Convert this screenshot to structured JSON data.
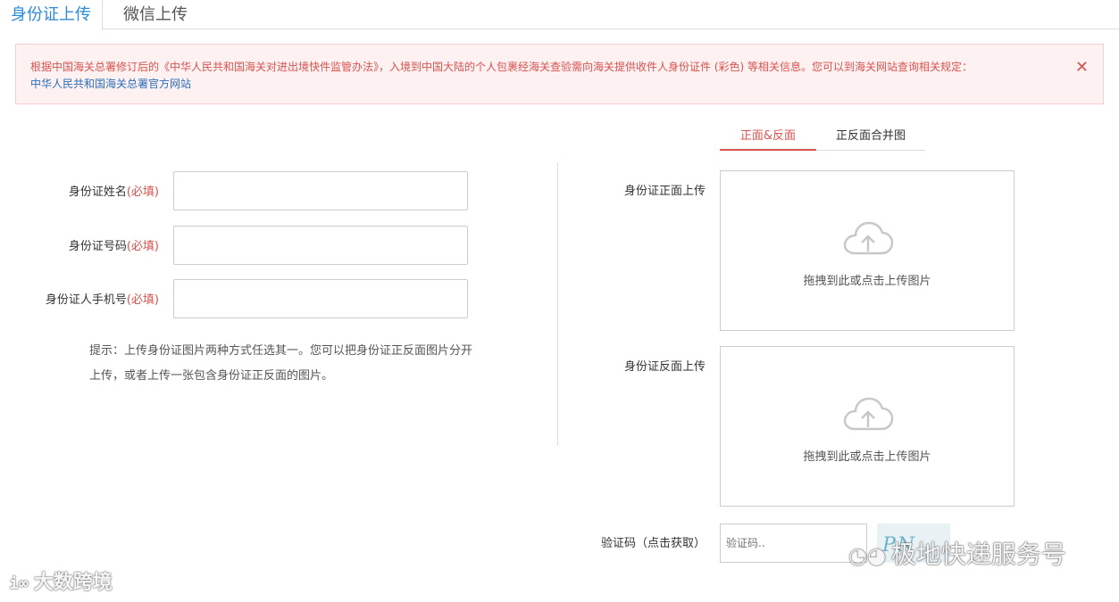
{
  "tabs": [
    {
      "label": "身份证上传"
    },
    {
      "label": "微信上传"
    }
  ],
  "notice": {
    "text": "根据中国海关总署修订后的《中华人民共和国海关对进出境快件监管办法》，入境到中国大陆的个人包裹经海关查验需向海关提供收件人身份证件 (彩色) 等相关信息。您可以到海关网站查询相关规定：",
    "link": "中华人民共和国海关总署官方网站",
    "close": "✕"
  },
  "form": {
    "required_mark": "(必填)",
    "name_label": "身份证姓名",
    "id_label": "身份证号码",
    "phone_label": "身份证人手机号",
    "name_value": "",
    "id_value": "",
    "phone_value": ""
  },
  "hint": {
    "line1": "提示：上传身份证图片两种方式任选其一。您可以把身份证正反面图片分开",
    "line2": "上传，或者上传一张包含身份证正反面的图片。"
  },
  "subtabs": [
    {
      "label": "正面&反面"
    },
    {
      "label": "正反面合并图"
    }
  ],
  "upload": {
    "front_label": "身份证正面上传",
    "back_label": "身份证反面上传",
    "prompt": "拖拽到此或点击上传图片"
  },
  "captcha": {
    "label": "验证码（点击获取）",
    "placeholder": "验证码..",
    "image_text": "PN"
  },
  "watermarks": {
    "left_logo": "i∞",
    "left_text": "大数跨境",
    "right_text": "极地快递服务号"
  },
  "colors": {
    "accent": "#2a8bd6",
    "danger": "#d9534f",
    "notice_bg": "#fdf1f1"
  }
}
